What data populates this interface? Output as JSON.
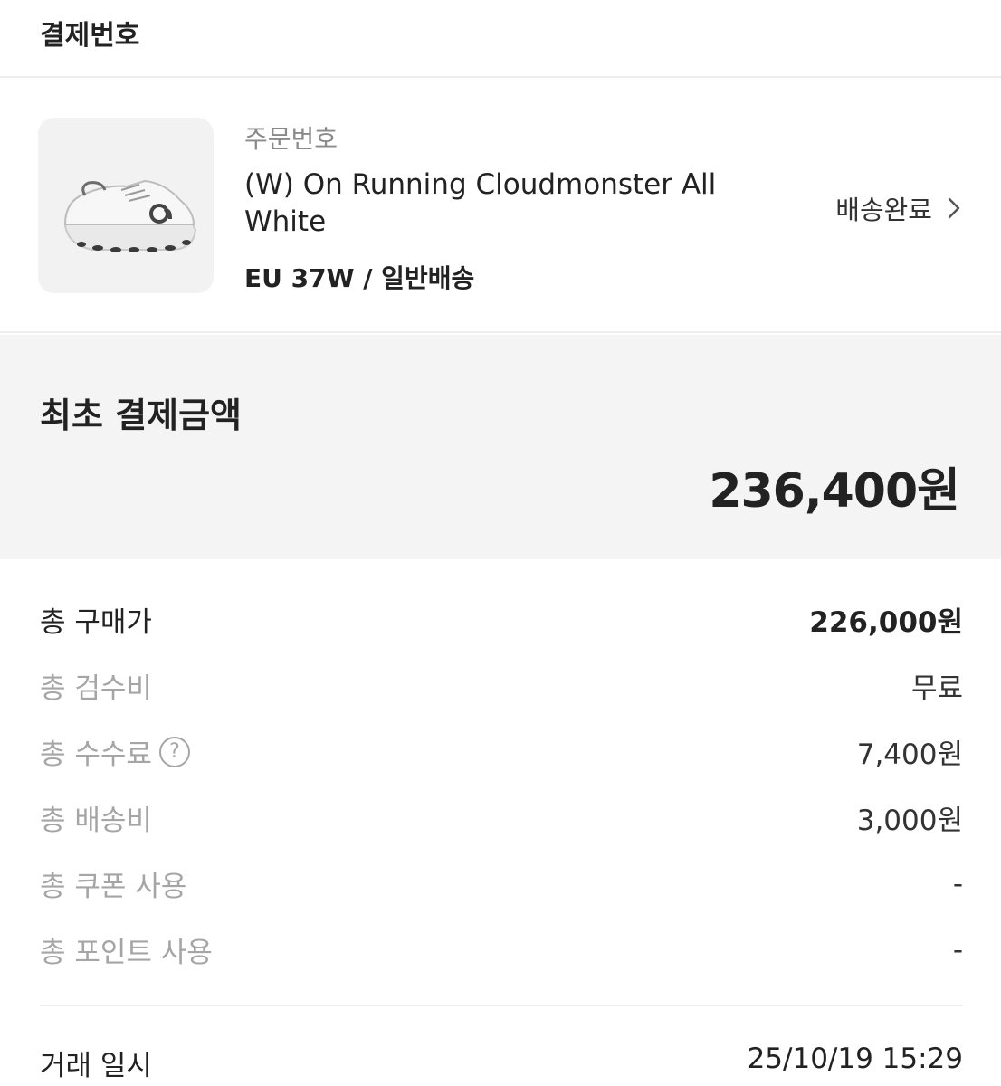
{
  "header": {
    "title": "결제번호"
  },
  "product": {
    "image_icon": "sneaker-image",
    "order_label": "주문번호",
    "name": "(W) On Running Cloudmonster All White",
    "option": "EU 37W / 일반배송",
    "status": "배송완료"
  },
  "total": {
    "label": "최초 결제금액",
    "amount": "236,400원"
  },
  "details": [
    {
      "label": "총 구매가",
      "value": "226,000원"
    },
    {
      "label": "총 검수비",
      "value": "무료"
    },
    {
      "label": "총 수수료",
      "value": "7,400원",
      "help": "?"
    },
    {
      "label": "총 배송비",
      "value": "3,000원"
    },
    {
      "label": "총 쿠폰 사용",
      "value": "-"
    },
    {
      "label": "총 포인트 사용",
      "value": "-"
    }
  ],
  "trade": {
    "label": "거래 일시",
    "value": "25/10/19 15:29"
  },
  "colors": {
    "background": "#ffffff",
    "panel": "#f4f4f4",
    "muted_text": "#a5a5a5",
    "text": "#222222"
  }
}
